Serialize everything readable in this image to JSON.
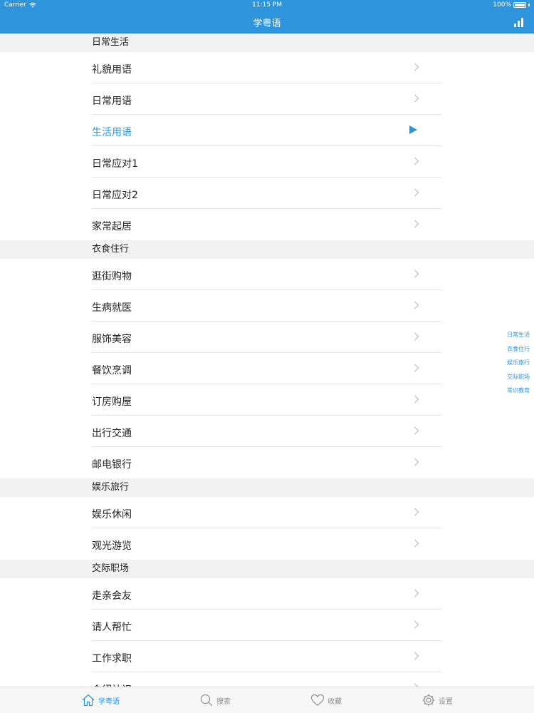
{
  "status_bar": {
    "carrier": "Carrier",
    "time": "11:15 PM",
    "battery": "100%"
  },
  "nav": {
    "title": "学粤语",
    "right_icon": "stats-bars-icon"
  },
  "sections": [
    {
      "title": "日常生活",
      "items": [
        "礼貌用语",
        "日常用语",
        "生活用语",
        "日常应对1",
        "日常应对2",
        "家常起居"
      ]
    },
    {
      "title": "衣食住行",
      "items": [
        "逛街购物",
        "生病就医",
        "服饰美容",
        "餐饮烹调",
        "订房购屋",
        "出行交通",
        "邮电银行"
      ]
    },
    {
      "title": "娱乐旅行",
      "items": [
        "娱乐休闲",
        "观光游览"
      ]
    },
    {
      "title": "交际职场",
      "items": [
        "走亲会友",
        "请人帮忙",
        "工作求职",
        "介绍认识"
      ]
    }
  ],
  "active_item": "生活用语",
  "index": [
    "日常生活",
    "衣食住行",
    "娱乐旅行",
    "交际职场",
    "常识教育"
  ],
  "tabs": [
    {
      "label": "学粤语",
      "icon": "home-icon",
      "active": true
    },
    {
      "label": "搜索",
      "icon": "search-icon",
      "active": false
    },
    {
      "label": "收藏",
      "icon": "heart-icon",
      "active": false
    },
    {
      "label": "设置",
      "icon": "gear-icon",
      "active": false
    }
  ],
  "colors": {
    "accent": "#2e95dc",
    "section_bg": "#f2f2f2",
    "tab_bg": "#f7f7f7"
  }
}
